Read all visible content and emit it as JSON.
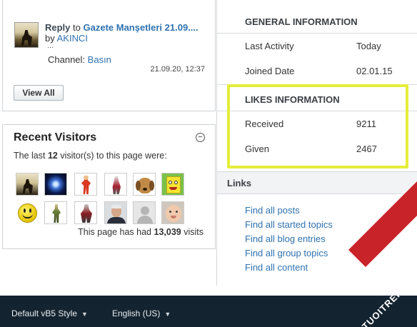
{
  "reply": {
    "prefix": "Reply",
    "to_word": "to",
    "topic": "Gazete Manşetleri 21.09....",
    "by_word": "by",
    "author": "AKINCI",
    "ellipsis": "...",
    "channel_label": "Channel:",
    "channel": "Basın",
    "date": "21.09.20, 12:37",
    "view_all": "View All"
  },
  "recent_visitors": {
    "title": "Recent Visitors",
    "collapse": "−",
    "text_before": "The last",
    "count": "12",
    "text_after": "visitor(s) to this page were:",
    "visits_before": "This page has had",
    "visits_count": "13,039",
    "visits_after": "visits",
    "avatars": [
      "rider-avatar",
      "blue-orb-avatar",
      "fighter-avatar",
      "assassin-avatar",
      "dog-avatar",
      "sponge-avatar",
      "smiley-avatar",
      "soldier-avatar",
      "warrior-avatar",
      "man-avatar",
      "default-avatar",
      "baby-avatar"
    ]
  },
  "general": {
    "title": "GENERAL INFORMATION",
    "rows": [
      {
        "label": "Last Activity",
        "value": "Today"
      },
      {
        "label": "Joined Date",
        "value": "02.01.15"
      }
    ]
  },
  "likes": {
    "title": "LIKES INFORMATION",
    "rows": [
      {
        "label": "Received",
        "value": "9211"
      },
      {
        "label": "Given",
        "value": "2467"
      }
    ]
  },
  "links": {
    "title": "Links",
    "items": [
      "Find all posts",
      "Find all started topics",
      "Find all blog entries",
      "Find all group topics",
      "Find all content"
    ]
  },
  "footer": {
    "style": "Default vB5 Style",
    "language": "English (US)"
  },
  "watermark": "TUOITREIT.VN",
  "colors": {
    "link": "#2f72b0",
    "highlight": "#e4ed3a",
    "footer_bg": "#13232f",
    "watermark_band": "#c9232a"
  }
}
